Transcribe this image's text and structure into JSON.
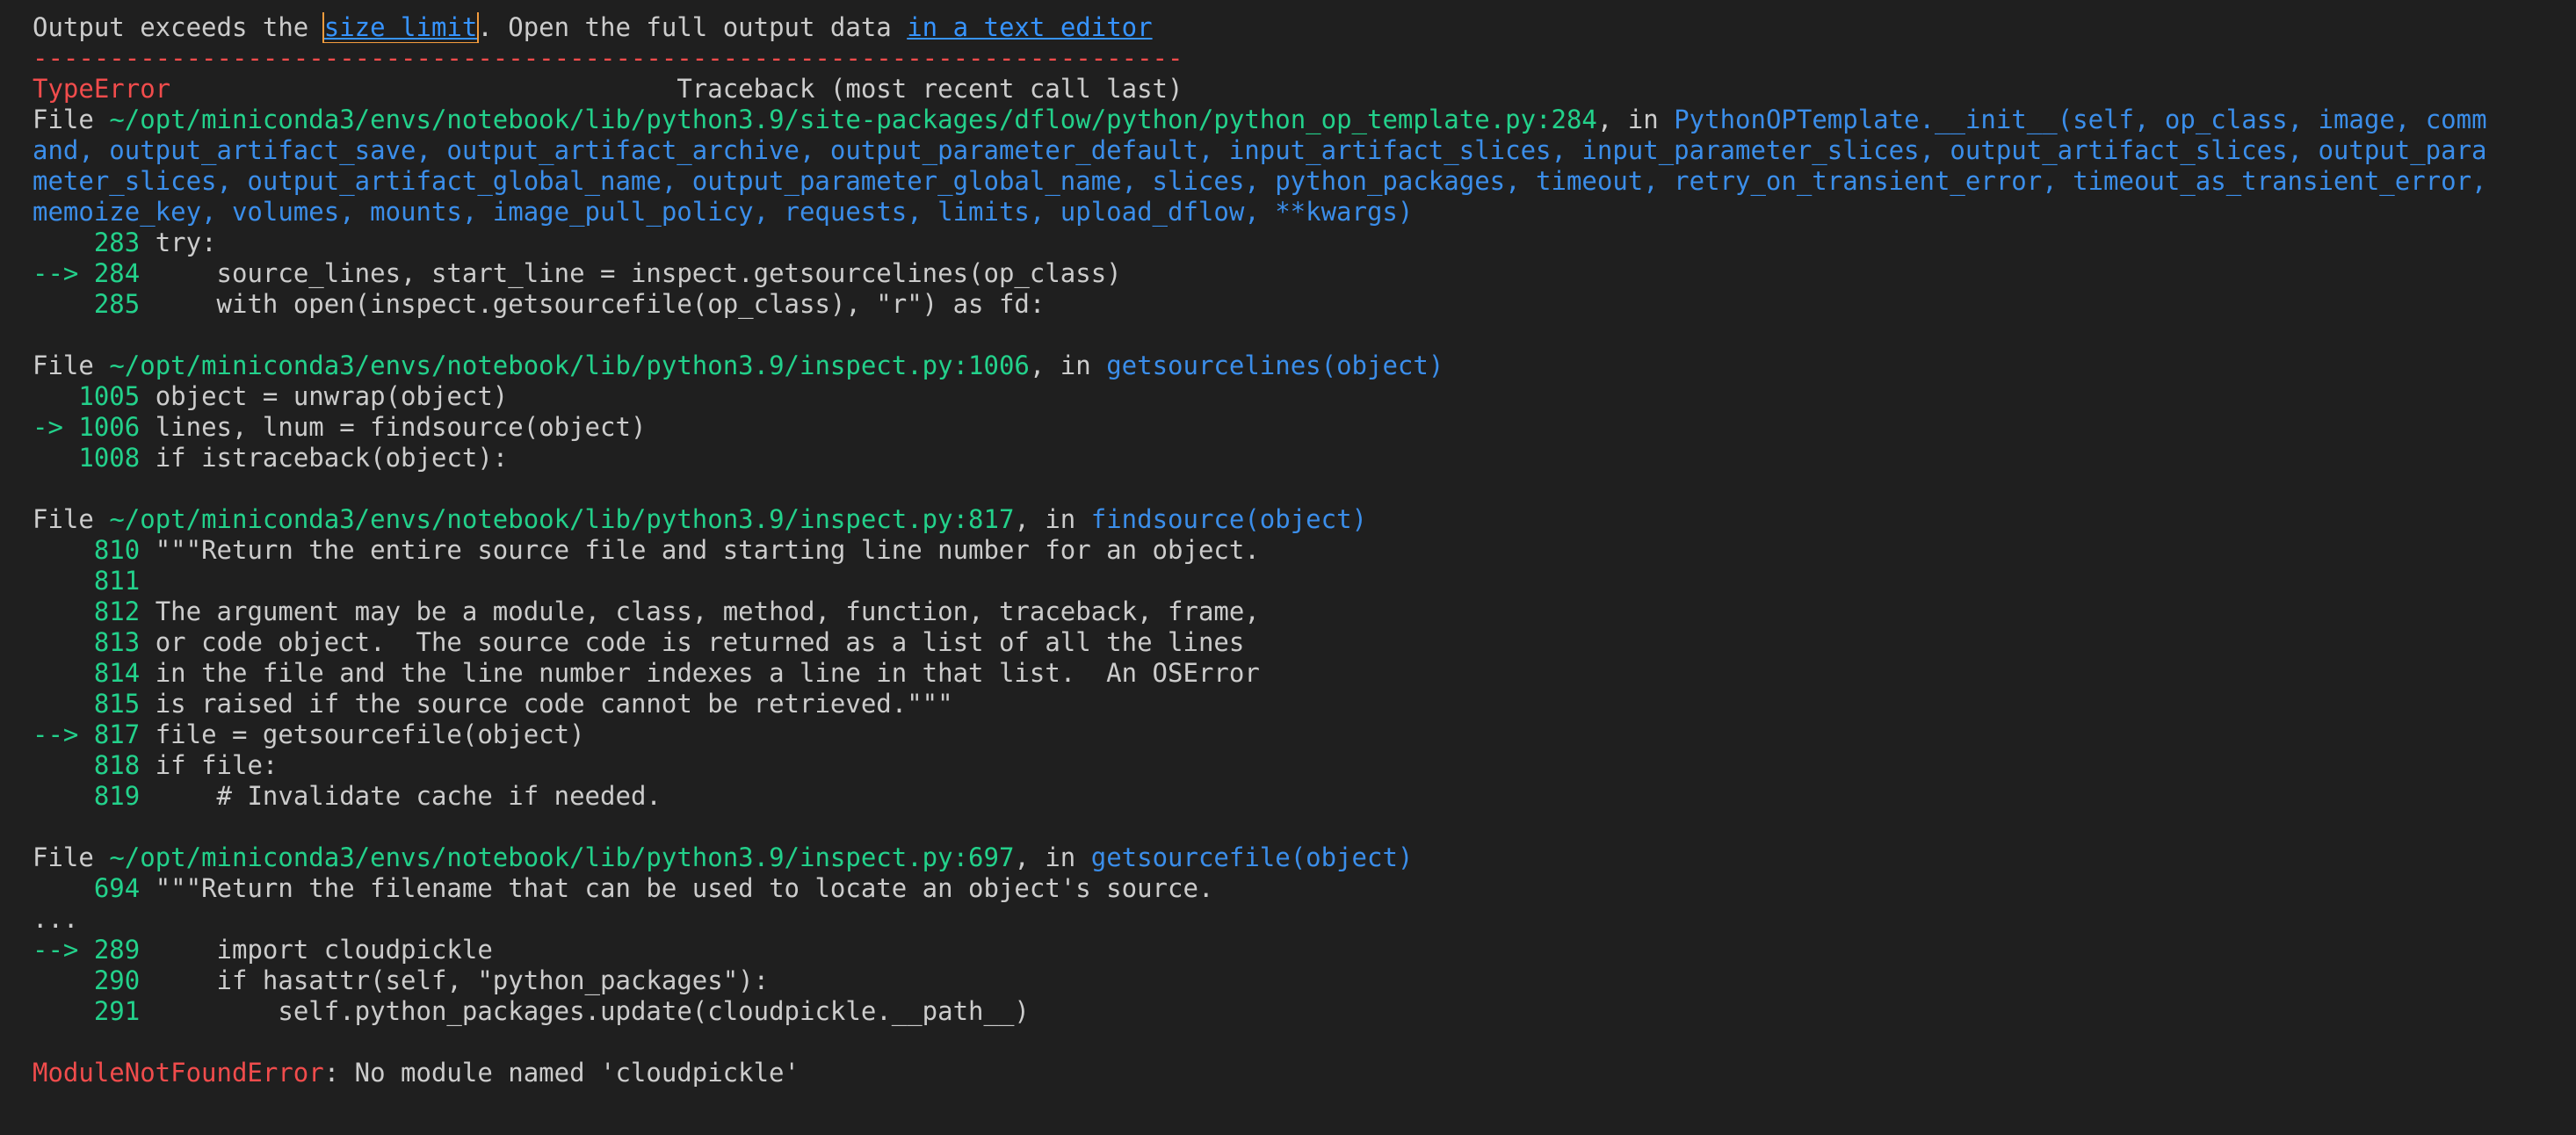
{
  "banner": {
    "prefix": "Output exceeds the ",
    "size_limit_link": "size limit",
    "middle": ". Open the full output data ",
    "editor_link": "in a text editor"
  },
  "separator": "---------------------------------------------------------------------------",
  "header": {
    "error_name": "TypeError",
    "spacer": "                                 ",
    "traceback_title": "Traceback (most recent call last)"
  },
  "frames": [
    {
      "file_label": "File ",
      "path": "~/opt/miniconda3/envs/notebook/lib/python3.9/site-packages/dflow/python/python_op_template.py:284",
      "in_label": ", in ",
      "func_lines": [
        "PythonOPTemplate.__init__(self, op_class, image, command, output_artifact_save, output_artifact_archive, output_parameter_default, input_artifact_slices, input_parameter_slices, output_artifact_slices, output_parameter_slices, output_artifact_global_name, output_parameter_global_name, slices, python_packages, timeout, retry_on_transient_error, timeout_as_transient_error, memoize_key, volumes, mounts, image_pull_policy, requests, limits, upload_dflow, **kwargs)"
      ],
      "func_display": [
        "PythonOPTemplate.__init__(self, op_class, image, comm",
        "and, output_artifact_save, output_artifact_archive, output_parameter_default, input_artifact_slices, input_parameter_slices, output_artifact_slices, output_para",
        "meter_slices, output_artifact_global_name, output_parameter_global_name, slices, python_packages, timeout, retry_on_transient_error, timeout_as_transient_error,",
        "memoize_key, volumes, mounts, image_pull_policy, requests, limits, upload_dflow, **kwargs)"
      ],
      "code": [
        {
          "marker": "    ",
          "num": "283",
          "text": " try:"
        },
        {
          "marker": "--> ",
          "num": "284",
          "text": "     source_lines, start_line = inspect.getsourcelines(op_class)"
        },
        {
          "marker": "    ",
          "num": "285",
          "text": "     with open(inspect.getsourcefile(op_class), \"r\") as fd:"
        }
      ]
    },
    {
      "file_label": "File ",
      "path": "~/opt/miniconda3/envs/notebook/lib/python3.9/inspect.py:1006",
      "in_label": ", in ",
      "func": "getsourcelines(object)",
      "code": [
        {
          "marker": "   ",
          "num": "1005",
          "text": " object = unwrap(object)"
        },
        {
          "marker": "-> ",
          "num": "1006",
          "text": " lines, lnum = findsource(object)"
        },
        {
          "marker": "   ",
          "num": "1008",
          "text": " if istraceback(object):"
        }
      ]
    },
    {
      "file_label": "File ",
      "path": "~/opt/miniconda3/envs/notebook/lib/python3.9/inspect.py:817",
      "in_label": ", in ",
      "func": "findsource(object)",
      "code": [
        {
          "marker": "    ",
          "num": "810",
          "text": " \"\"\"Return the entire source file and starting line number for an object."
        },
        {
          "marker": "    ",
          "num": "811",
          "text": ""
        },
        {
          "marker": "    ",
          "num": "812",
          "text": " The argument may be a module, class, method, function, traceback, frame,"
        },
        {
          "marker": "    ",
          "num": "813",
          "text": " or code object.  The source code is returned as a list of all the lines"
        },
        {
          "marker": "    ",
          "num": "814",
          "text": " in the file and the line number indexes a line in that list.  An OSError"
        },
        {
          "marker": "    ",
          "num": "815",
          "text": " is raised if the source code cannot be retrieved.\"\"\""
        },
        {
          "marker": "--> ",
          "num": "817",
          "text": " file = getsourcefile(object)"
        },
        {
          "marker": "    ",
          "num": "818",
          "text": " if file:"
        },
        {
          "marker": "    ",
          "num": "819",
          "text": "     # Invalidate cache if needed."
        }
      ]
    },
    {
      "file_label": "File ",
      "path": "~/opt/miniconda3/envs/notebook/lib/python3.9/inspect.py:697",
      "in_label": ", in ",
      "func": "getsourcefile(object)",
      "code": [
        {
          "marker": "    ",
          "num": "694",
          "text": " \"\"\"Return the filename that can be used to locate an object's source."
        }
      ]
    }
  ],
  "ellipsis": "...",
  "tail_code": [
    {
      "marker": "--> ",
      "num": "289",
      "text": "     import cloudpickle"
    },
    {
      "marker": "    ",
      "num": "290",
      "text": "     if hasattr(self, \"python_packages\"):"
    },
    {
      "marker": "    ",
      "num": "291",
      "text": "         self.python_packages.update(cloudpickle.__path__)"
    }
  ],
  "final_error": {
    "name": "ModuleNotFoundError",
    "message": ": No module named 'cloudpickle'"
  },
  "colors": {
    "background": "#1f1f1f",
    "text": "#cccccc",
    "error_red": "#f14c4c",
    "path_green": "#23d18b",
    "func_blue": "#3b8eea",
    "link_blue": "#3794ff",
    "focus_orange": "#f39c3d"
  }
}
